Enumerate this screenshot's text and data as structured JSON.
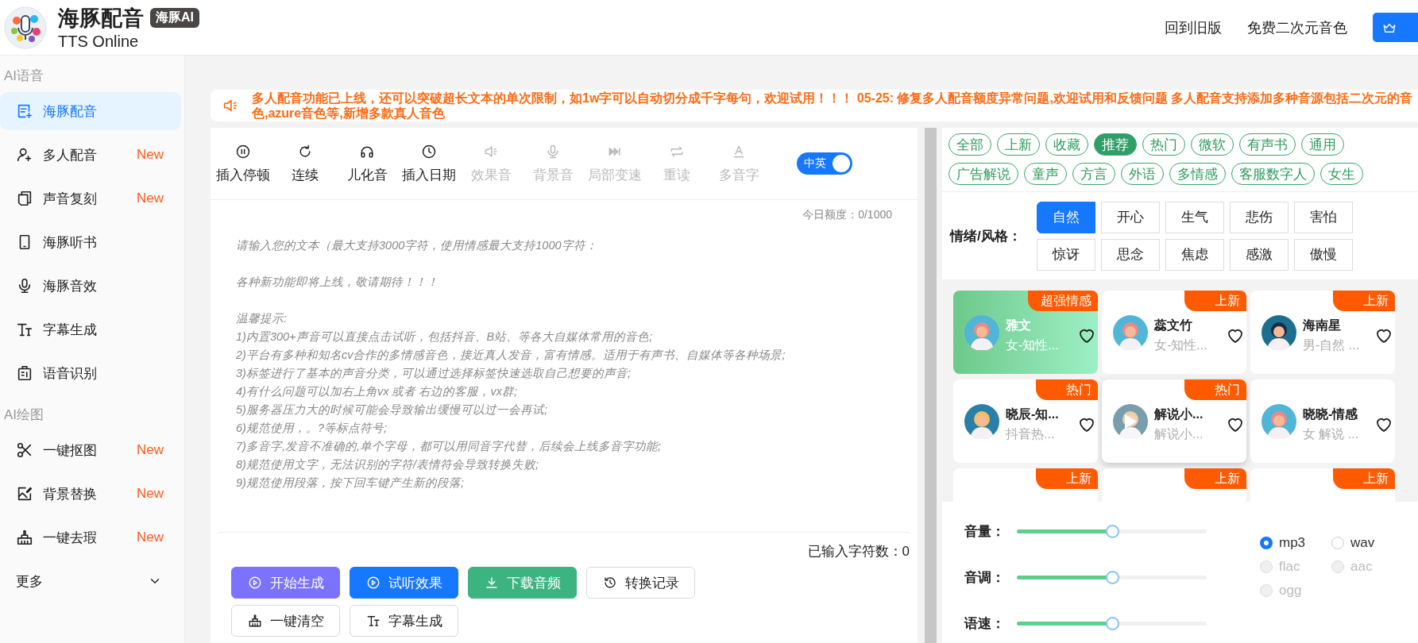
{
  "header": {
    "title": "海豚配音",
    "badge": "海豚AI",
    "subtitle": "TTS Online",
    "links": [
      "回到旧版",
      "免费二次元音色"
    ]
  },
  "sidebar": {
    "sections": [
      {
        "label": "AI语音",
        "items": [
          {
            "label": "海豚配音",
            "selected": true
          },
          {
            "label": "多人配音",
            "selected": false,
            "badge": "New"
          },
          {
            "label": "声音复刻",
            "selected": false,
            "badge": "New"
          },
          {
            "label": "海豚听书",
            "selected": false
          },
          {
            "label": "海豚音效",
            "selected": false
          },
          {
            "label": "字幕生成",
            "selected": false
          },
          {
            "label": "语音识别",
            "selected": false
          }
        ]
      },
      {
        "label": "AI绘图",
        "items": [
          {
            "label": "一键抠图",
            "selected": false,
            "badge": "New"
          },
          {
            "label": "背景替换",
            "selected": false,
            "badge": "New"
          },
          {
            "label": "一键去瑕",
            "selected": false,
            "badge": "New"
          }
        ]
      }
    ],
    "more": {
      "label": "更多",
      "expanded": false
    }
  },
  "notice": "多人配音功能已上线，还可以突破超长文本的单次限制，如1w字可以自动切分成千字每句，欢迎试用！！！ 05-25: 修复多人配音额度异常问题,欢迎试用和反馈问题 多人配音支持添加多种音源包括二次元的音色,azure音色等,新增多款真人音色",
  "editor": {
    "tools": [
      {
        "label": "插入停顿",
        "disabled": false
      },
      {
        "label": "连续",
        "disabled": false
      },
      {
        "label": "儿化音",
        "disabled": false
      },
      {
        "label": "插入日期",
        "disabled": false
      },
      {
        "label": "效果音",
        "disabled": true
      },
      {
        "label": "背景音",
        "disabled": true
      },
      {
        "label": "局部变速",
        "disabled": true
      },
      {
        "label": "重读",
        "disabled": true
      },
      {
        "label": "多音字",
        "disabled": true
      }
    ],
    "toggle": {
      "label": "中英",
      "on": true
    },
    "quota": "今日额度：0/1000",
    "placeholder": [
      [
        "请输入您的文本（最大支持3000字符，使用情感最大支持1000字符："
      ],
      [
        "各种新功能即将上线，敬请期待！！！"
      ],
      [
        "温馨提示:",
        "1)内置300+声音可以直接点击试听，包括抖音、B站、等各大自媒体常用的音色;",
        "2)平台有多种和知名cv合作的多情感音色，接近真人发音，富有情感。适用于有声书、自媒体等各种场景;",
        "3)标签进行了基本的声音分类，可以通过选择标签快速选取自己想要的声音;",
        "4)有什么问题可以加右上角vx 或者 右边的客服，vx群;",
        "5)服务器压力大的时候可能会导致输出缓慢可以过一会再试;",
        "6)规范使用，。?等标点符号;",
        "7)多音字,发音不准确的,单个字母，都可以用同音字代替，后续会上线多音字功能;",
        "8)规范使用文字，无法识别的字符/表情符会导致转换失败;",
        "9)规范使用段落，按下回车键产生新的段落;"
      ]
    ],
    "char_count": "已输入字符数：0",
    "buttons": [
      {
        "label": "开始生成",
        "kind": "purple"
      },
      {
        "label": "试听效果",
        "kind": "blue"
      },
      {
        "label": "下载音频",
        "kind": "green"
      },
      {
        "label": "转换记录",
        "kind": "plain"
      },
      {
        "label": "一键清空",
        "kind": "plain"
      },
      {
        "label": "字幕生成",
        "kind": "plain"
      }
    ]
  },
  "voices": {
    "tags": [
      {
        "label": "全部",
        "selected": false
      },
      {
        "label": "上新",
        "selected": false
      },
      {
        "label": "收藏",
        "selected": false
      },
      {
        "label": "推荐",
        "selected": true
      },
      {
        "label": "热门",
        "selected": false
      },
      {
        "label": "微软",
        "selected": false
      },
      {
        "label": "有声书",
        "selected": false
      },
      {
        "label": "通用",
        "selected": false
      },
      {
        "label": "广告解说",
        "selected": false
      },
      {
        "label": "童声",
        "selected": false
      },
      {
        "label": "方言",
        "selected": false
      },
      {
        "label": "外语",
        "selected": false
      },
      {
        "label": "多情感",
        "selected": false
      },
      {
        "label": "客服数字人",
        "selected": false
      },
      {
        "label": "女生",
        "selected": false
      }
    ],
    "emotion_label": "情绪/风格：",
    "emotions": [
      {
        "label": "自然",
        "selected": true
      },
      {
        "label": "开心",
        "selected": false
      },
      {
        "label": "生气",
        "selected": false
      },
      {
        "label": "悲伤",
        "selected": false
      },
      {
        "label": "害怕",
        "selected": false
      },
      {
        "label": "惊讶",
        "selected": false
      },
      {
        "label": "思念",
        "selected": false
      },
      {
        "label": "焦虑",
        "selected": false
      },
      {
        "label": "感激",
        "selected": false
      },
      {
        "label": "傲慢",
        "selected": false
      }
    ],
    "cards": [
      {
        "name": "雅文",
        "desc": "女-知性...",
        "badge": "超强情感",
        "selected": true,
        "playing": false
      },
      {
        "name": "蕊文竹",
        "desc": "女-知性...",
        "badge": "上新",
        "selected": false,
        "playing": false
      },
      {
        "name": "海南星",
        "desc": "男-自然 ...",
        "badge": "上新",
        "selected": false,
        "playing": false
      },
      {
        "name": "晓辰-知...",
        "desc": "抖音热...",
        "badge": "热门",
        "selected": false,
        "playing": false
      },
      {
        "name": "解说小...",
        "desc": "解说小...",
        "badge": "热门",
        "selected": false,
        "playing": true
      },
      {
        "name": "晓晓-情感",
        "desc": "女 解说 ...",
        "selected": false,
        "playing": false
      },
      {
        "badge": "上新",
        "selected": false,
        "playing": false
      },
      {
        "badge": "上新",
        "selected": false,
        "playing": false
      },
      {
        "badge": "上新",
        "selected": false,
        "playing": false
      }
    ],
    "sliders": [
      {
        "label": "音量：",
        "level": 0.5
      },
      {
        "label": "音调：",
        "level": 0.5
      },
      {
        "label": "语速：",
        "level": 0.5
      }
    ],
    "formats": [
      {
        "label": "mp3",
        "selected": true,
        "disabled": false
      },
      {
        "label": "wav",
        "selected": false,
        "disabled": false
      },
      {
        "label": "flac",
        "selected": false,
        "disabled": true
      },
      {
        "label": "aac",
        "selected": false,
        "disabled": true
      },
      {
        "label": "ogg",
        "selected": false,
        "disabled": true
      }
    ]
  }
}
